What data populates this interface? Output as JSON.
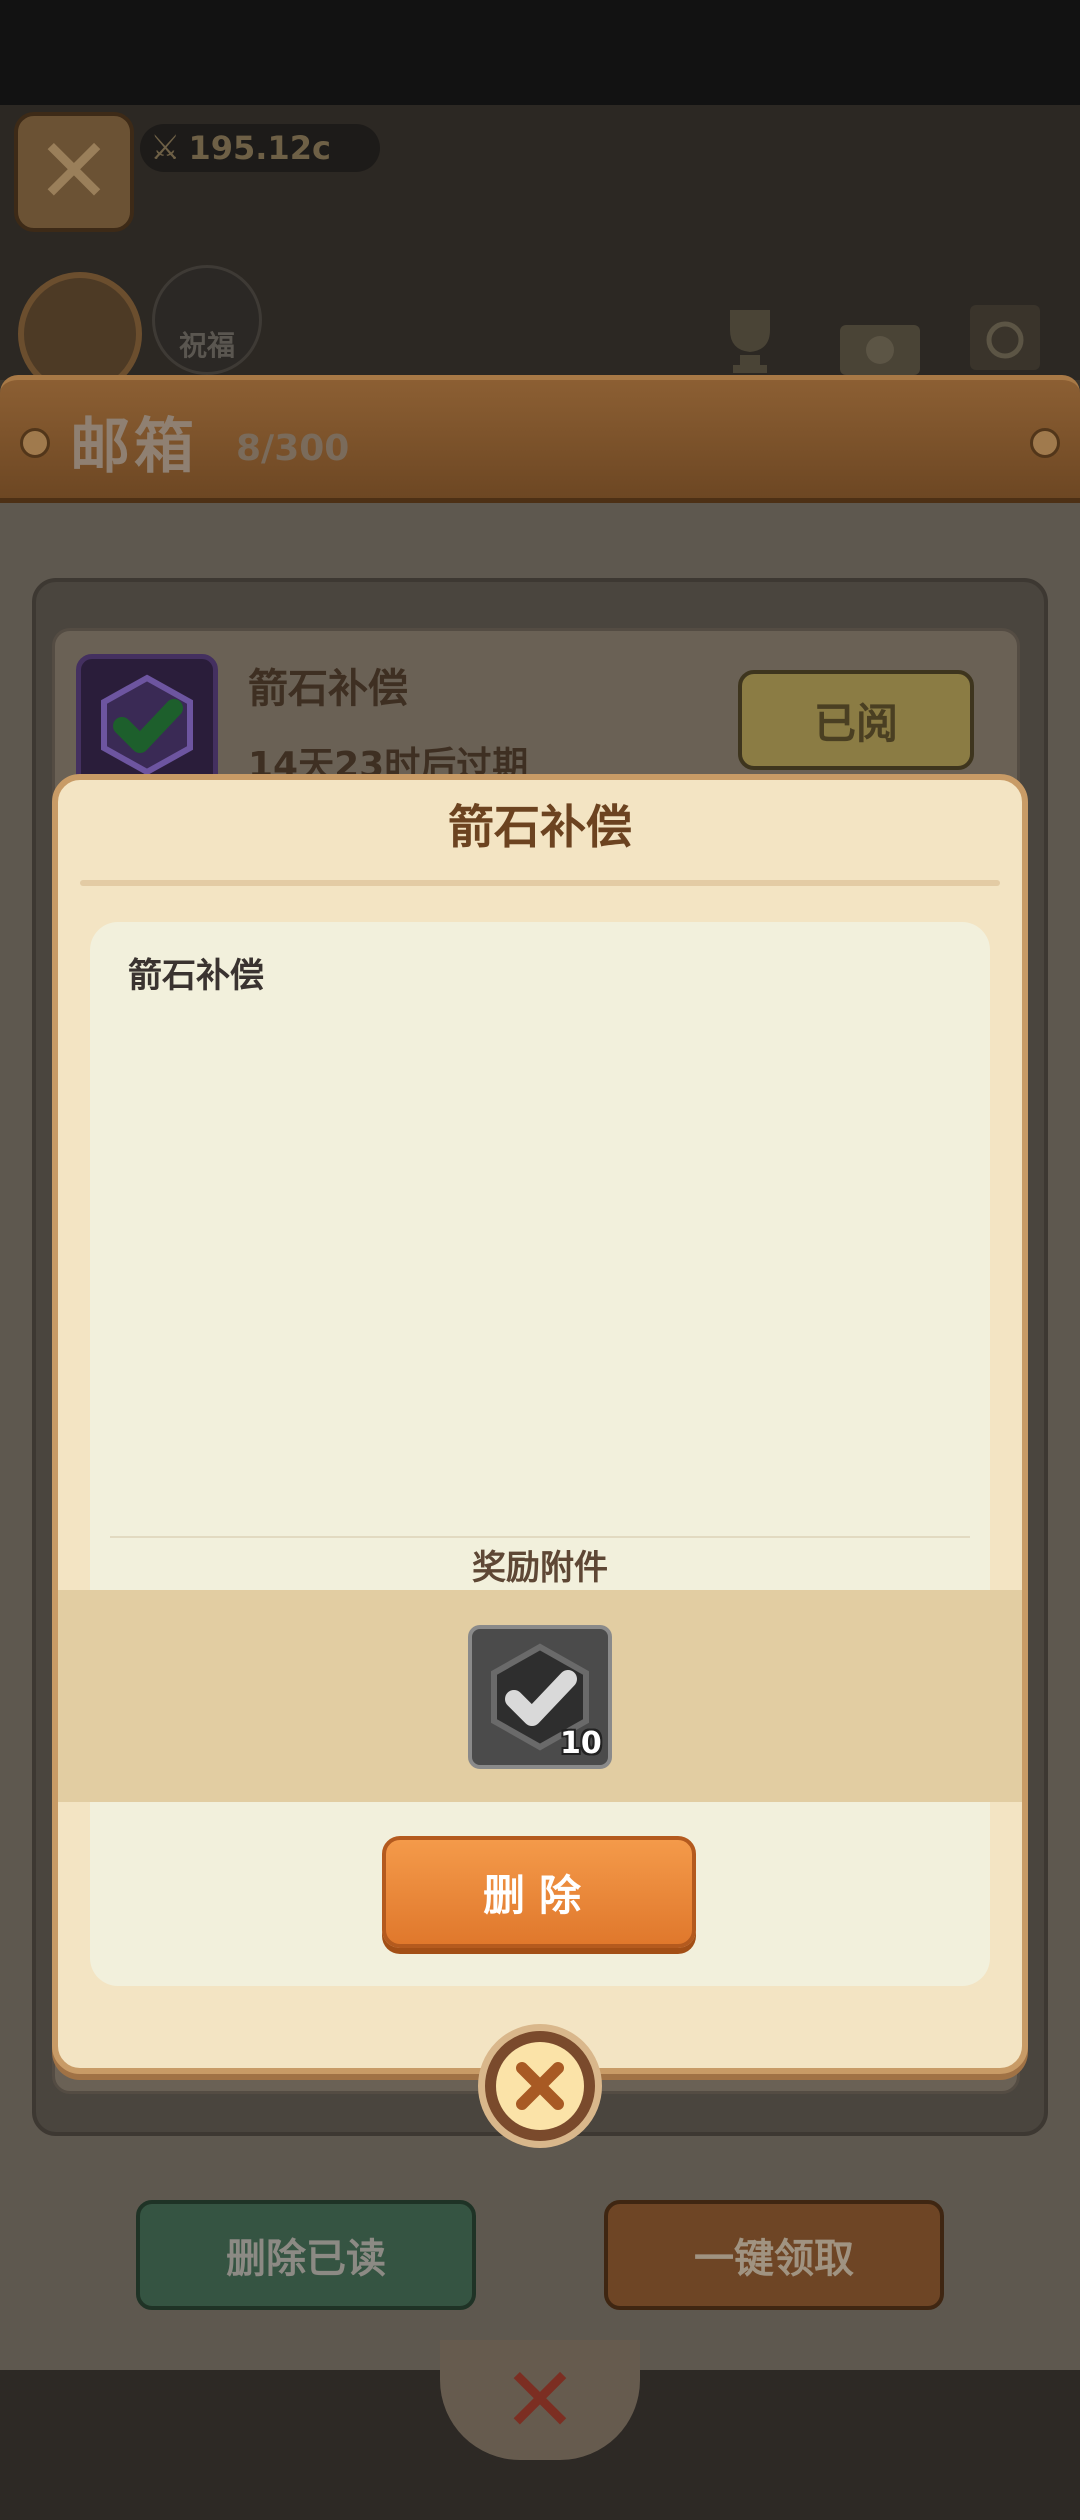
{
  "top_bar": {
    "power_value": "195.12c"
  },
  "scene": {
    "bless_label": "祝福",
    "icons": [
      "trophy-icon",
      "pass-ticket-icon",
      "special-card-icon"
    ]
  },
  "mailbox": {
    "title": "邮箱",
    "count": "8/300",
    "mail_item": {
      "title": "箭石补偿",
      "expire_text": "14天23时后过期",
      "read_label": "已阅",
      "icon": "whetstone-icon"
    },
    "delete_read_label": "删除已读",
    "claim_all_label": "一键领取"
  },
  "dialog": {
    "title": "箭石补偿",
    "body": "箭石补偿",
    "reward_label": "奖励附件",
    "reward_item": {
      "icon": "whetstone-icon",
      "quantity": "10"
    },
    "delete_label": "删除"
  },
  "colors": {
    "dialog_bg": "#f3e4c3",
    "delete_button": "#e98a3c",
    "title_text": "#6c4320"
  }
}
